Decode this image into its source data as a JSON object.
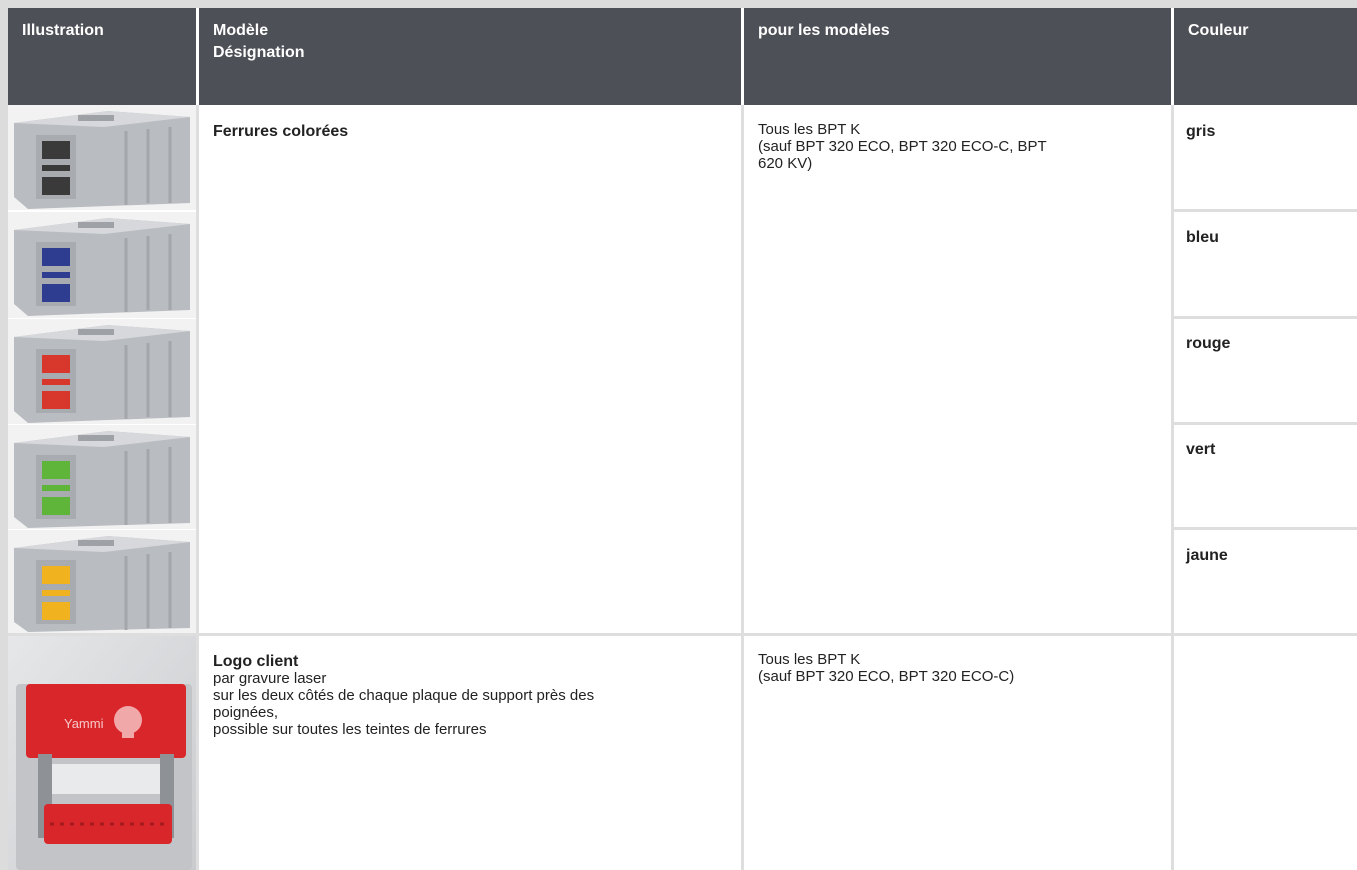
{
  "header": {
    "illustration": "Illustration",
    "model_line1": "Modèle",
    "model_line2": "Désignation",
    "for_models": "pour les modèles",
    "color": "Couleur"
  },
  "rows": [
    {
      "title": "Ferrures colorées",
      "models_line1": "Tous les BPT K",
      "models_line2": "(sauf BPT 320 ECO, BPT 320 ECO-C, BPT",
      "models_line3": "620 KV)",
      "colors": [
        {
          "label": "gris",
          "swatch": "#3a3a3a"
        },
        {
          "label": "bleu",
          "swatch": "#2e3d8f"
        },
        {
          "label": "rouge",
          "swatch": "#d8382b"
        },
        {
          "label": "vert",
          "swatch": "#5fb53a"
        },
        {
          "label": "jaune",
          "swatch": "#f0b21e"
        }
      ]
    },
    {
      "title": "Logo client",
      "desc_line1": "par gravure laser",
      "desc_line2": "sur les deux côtés de chaque plaque de support près des",
      "desc_line3": "poignées,",
      "desc_line4": "possible sur toutes les teintes de ferrures",
      "models_line1": "Tous les BPT K",
      "models_line2": "(sauf BPT 320 ECO, BPT 320 ECO-C)",
      "logo_text": "Yammi",
      "plate_color": "#d9262a"
    }
  ]
}
